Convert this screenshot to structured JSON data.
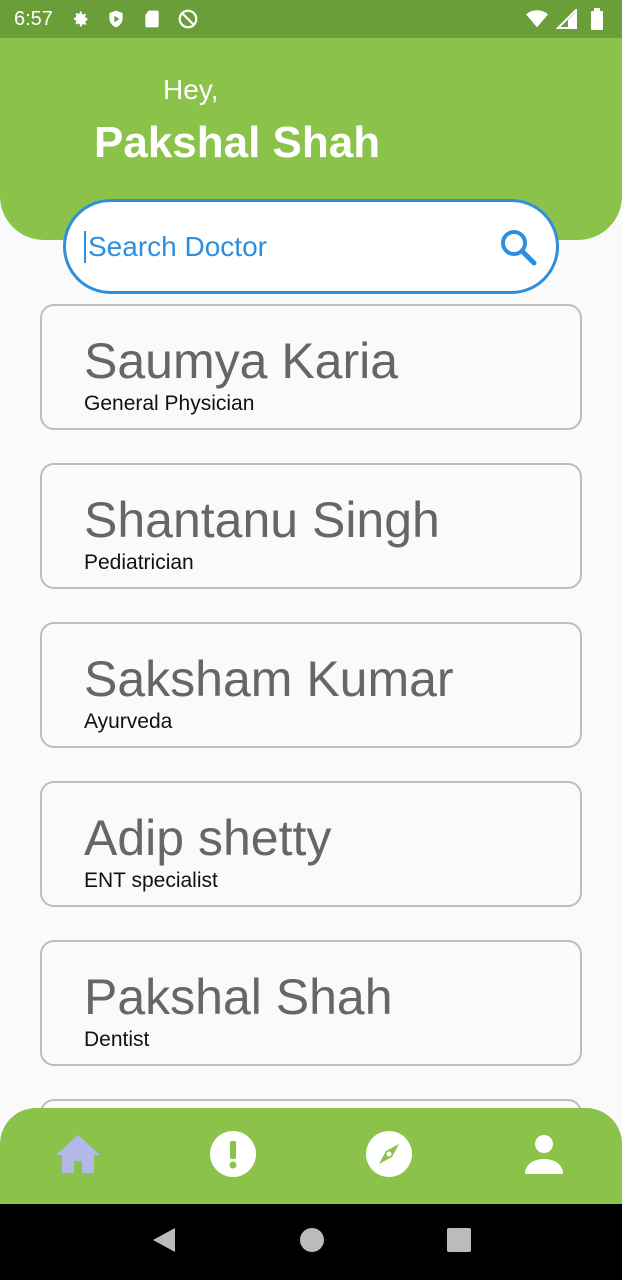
{
  "status_bar": {
    "time": "6:57"
  },
  "header": {
    "greeting": "Hey,",
    "user_name": "Pakshal Shah"
  },
  "search": {
    "placeholder": "Search Doctor"
  },
  "doctors": [
    {
      "name": "Saumya Karia",
      "specialty": "General Physician"
    },
    {
      "name": "Shantanu Singh",
      "specialty": "Pediatrician"
    },
    {
      "name": "Saksham Kumar",
      "specialty": "Ayurveda"
    },
    {
      "name": "Adip shetty",
      "specialty": "ENT specialist"
    },
    {
      "name": "Pakshal Shah",
      "specialty": "Dentist"
    },
    {
      "name": "",
      "specialty": ""
    }
  ],
  "bottom_nav": {
    "items": [
      "home-icon",
      "alert-icon",
      "compass-icon",
      "person-icon"
    ],
    "active": "home-icon"
  },
  "colors": {
    "primary_green": "#8bc34a",
    "status_green": "#6a9e38",
    "accent_blue": "#2f8fdf",
    "active_nav": "#b3b8e8"
  }
}
